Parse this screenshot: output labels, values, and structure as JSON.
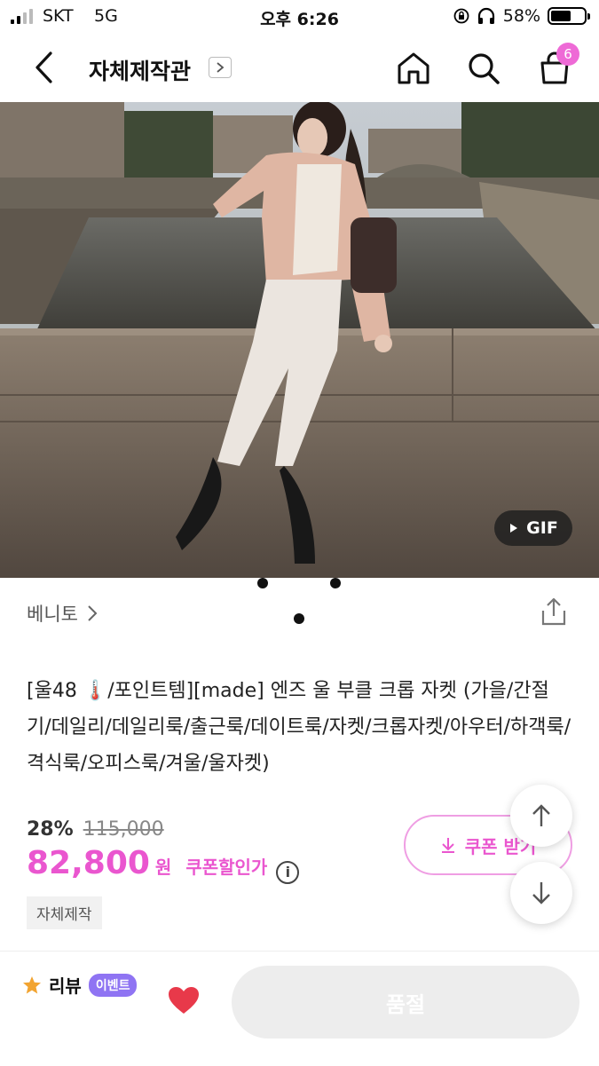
{
  "status_bar": {
    "carrier": "SKT",
    "network": "5G",
    "time": "오후 6:26",
    "battery": "58%"
  },
  "header": {
    "title": "자체제작관",
    "cart_count": "6"
  },
  "product_image": {
    "gif_label": "GIF",
    "carousel_dots": 3
  },
  "brand": {
    "name": "베니토"
  },
  "product": {
    "title": "[울48 🌡️/포인트템][made] 엔즈 울 부클 크롭 자켓 (가을/간절기/데일리/데일리룩/출근룩/데이트룩/자켓/크롭자켓/아우터/하객룩/격식룩/오피스룩/겨울/울자켓)",
    "discount_rate": "28%",
    "original_price": "115,000",
    "price": "82,800",
    "currency": "원",
    "coupon_price_label": "쿠폰할인가",
    "tag": "자체제작"
  },
  "coupon_button": {
    "label": "쿠폰 받기"
  },
  "bottom_bar": {
    "review_label": "리뷰",
    "event_badge": "이벤트",
    "soldout_label": "품절"
  },
  "colors": {
    "accent": "#ea56cf",
    "badge": "#8f74f3",
    "heart": "#e8394a"
  }
}
